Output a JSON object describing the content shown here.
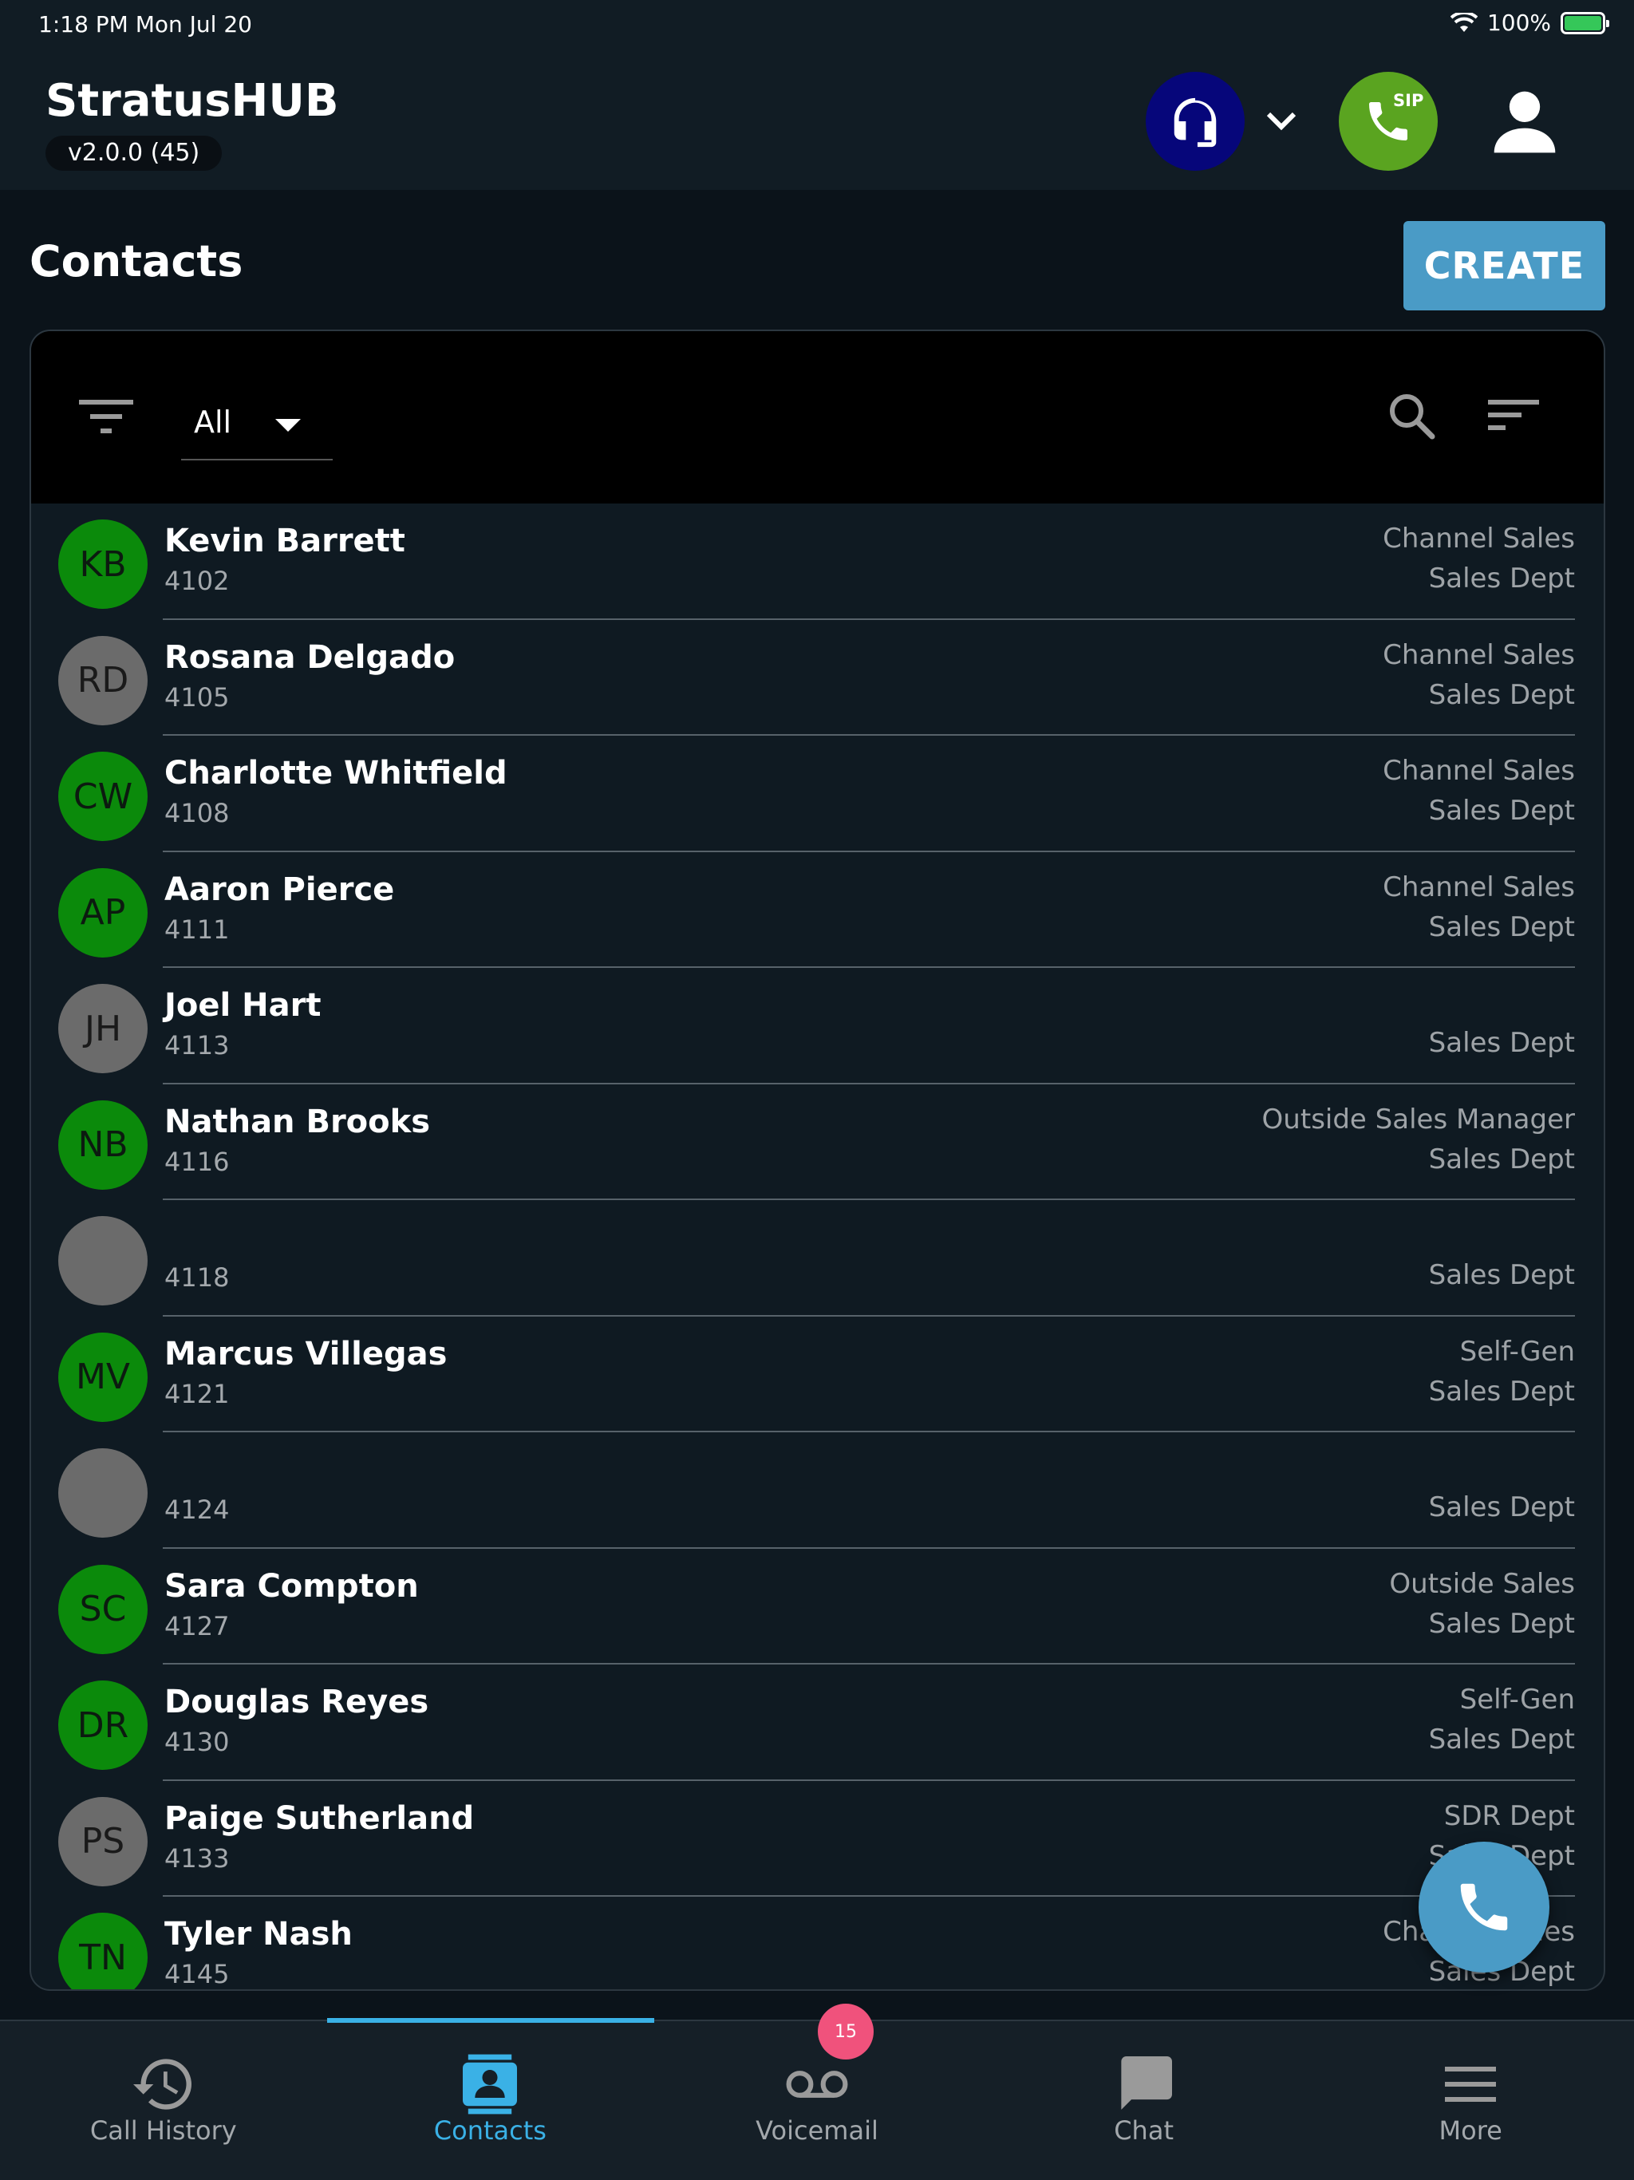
{
  "status_bar": {
    "time": "1:18 PM   Mon Jul 20",
    "battery": "100%",
    "battery_level": 1.0
  },
  "header": {
    "app_title": "StratusHUB",
    "version": "v2.0.0 (45)",
    "sip_label": "SIP",
    "colors": {
      "agent": "#06067a",
      "sip": "#5aa420"
    }
  },
  "page": {
    "title": "Contacts",
    "create_label": "CREATE"
  },
  "toolbar": {
    "filter_value": "All"
  },
  "contacts": [
    {
      "initials": "KB",
      "name": "Kevin Barrett",
      "ext": "4102",
      "role": "Channel Sales",
      "dept": "Sales Dept",
      "avatar_color": "green"
    },
    {
      "initials": "RD",
      "name": "Rosana Delgado",
      "ext": "4105",
      "role": "Channel Sales",
      "dept": "Sales Dept",
      "avatar_color": "gray"
    },
    {
      "initials": "CW",
      "name": "Charlotte Whitfield",
      "ext": "4108",
      "role": "Channel Sales",
      "dept": "Sales Dept",
      "avatar_color": "green"
    },
    {
      "initials": "AP",
      "name": "Aaron Pierce",
      "ext": "4111",
      "role": "Channel Sales",
      "dept": "Sales Dept",
      "avatar_color": "green"
    },
    {
      "initials": "JH",
      "name": "Joel Hart",
      "ext": "4113",
      "role": "",
      "dept": "Sales Dept",
      "avatar_color": "gray"
    },
    {
      "initials": "NB",
      "name": "Nathan Brooks",
      "ext": "4116",
      "role": "Outside Sales Manager",
      "dept": "Sales Dept",
      "avatar_color": "green"
    },
    {
      "initials": "",
      "name": "",
      "ext": "4118",
      "role": "",
      "dept": "Sales Dept",
      "avatar_color": "gray"
    },
    {
      "initials": "MV",
      "name": "Marcus Villegas",
      "ext": "4121",
      "role": "Self-Gen",
      "dept": "Sales Dept",
      "avatar_color": "green"
    },
    {
      "initials": "",
      "name": "",
      "ext": "4124",
      "role": "",
      "dept": "Sales Dept",
      "avatar_color": "gray"
    },
    {
      "initials": "SC",
      "name": "Sara Compton",
      "ext": "4127",
      "role": "Outside Sales",
      "dept": "Sales Dept",
      "avatar_color": "green"
    },
    {
      "initials": "DR",
      "name": "Douglas Reyes",
      "ext": "4130",
      "role": "Self-Gen",
      "dept": "Sales Dept",
      "avatar_color": "green"
    },
    {
      "initials": "PS",
      "name": "Paige Sutherland",
      "ext": "4133",
      "role": "SDR Dept",
      "dept": "Sales Dept",
      "avatar_color": "gray"
    },
    {
      "initials": "TN",
      "name": "Tyler Nash",
      "ext": "4145",
      "role": "Channel Sales",
      "dept": "Sales Dept",
      "avatar_color": "green"
    }
  ],
  "tabs": [
    {
      "label": "Call History",
      "icon": "history-icon"
    },
    {
      "label": "Contacts",
      "icon": "contacts-icon",
      "active": true
    },
    {
      "label": "Voicemail",
      "icon": "voicemail-icon",
      "badge": "15"
    },
    {
      "label": "Chat",
      "icon": "chat-icon"
    },
    {
      "label": "More",
      "icon": "menu-icon"
    }
  ]
}
